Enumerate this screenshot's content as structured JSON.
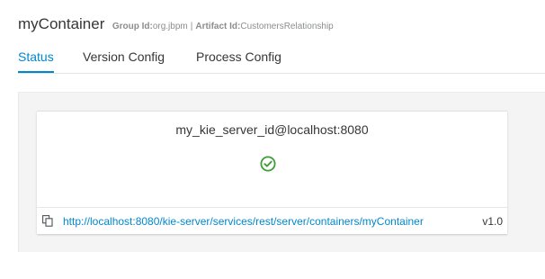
{
  "header": {
    "title": "myContainer",
    "group_label": "Group Id:",
    "group_value": "org.jbpm",
    "separator": "|",
    "artifact_label": "Artifact Id:",
    "artifact_value": "CustomersRelationship"
  },
  "tabs": [
    {
      "label": "Status",
      "active": true
    },
    {
      "label": "Version Config",
      "active": false
    },
    {
      "label": "Process Config",
      "active": false
    }
  ],
  "card": {
    "server_id": "my_kie_server_id@localhost:8080",
    "status_icon": "check-circle-icon",
    "status_color": "#3f9c35",
    "url": "http://localhost:8080/kie-server/services/rest/server/containers/myContainer",
    "version": "v1.0"
  },
  "colors": {
    "accent": "#0088ce",
    "ok": "#3f9c35"
  }
}
